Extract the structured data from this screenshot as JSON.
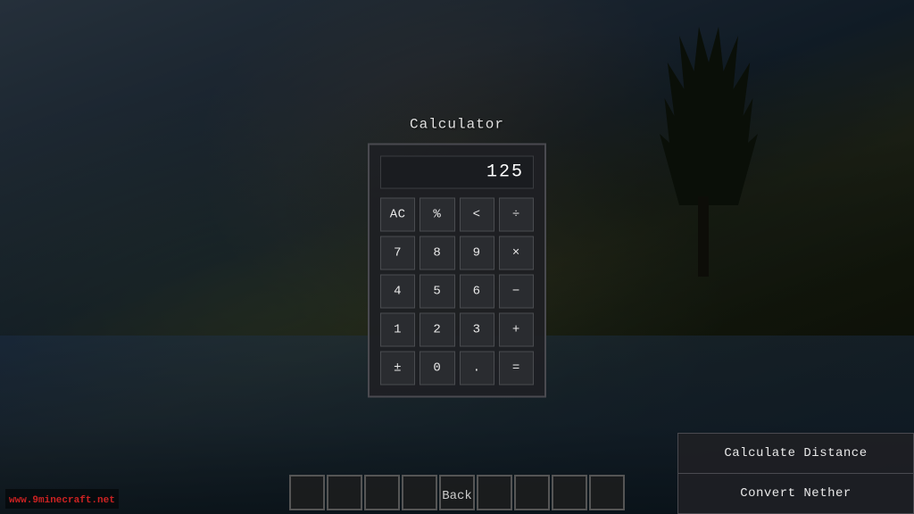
{
  "background": {
    "alt": "Minecraft landscape at sunset with water and trees"
  },
  "calculator": {
    "title": "Calculator",
    "display_value": "125",
    "buttons": [
      [
        "AC",
        "%",
        "<",
        "÷"
      ],
      [
        "7",
        "8",
        "9",
        "×"
      ],
      [
        "4",
        "5",
        "6",
        "−"
      ],
      [
        "1",
        "2",
        "3",
        "+"
      ],
      [
        "±",
        "0",
        ".",
        "="
      ]
    ]
  },
  "side_buttons": [
    {
      "label": "Calculate Distance",
      "id": "calculate-distance"
    },
    {
      "label": "Convert Nether",
      "id": "convert-nether"
    }
  ],
  "hotbar": {
    "slots": 9
  },
  "back_button": {
    "label": "Back"
  },
  "watermark": {
    "text": "www.9minecraft.net"
  }
}
